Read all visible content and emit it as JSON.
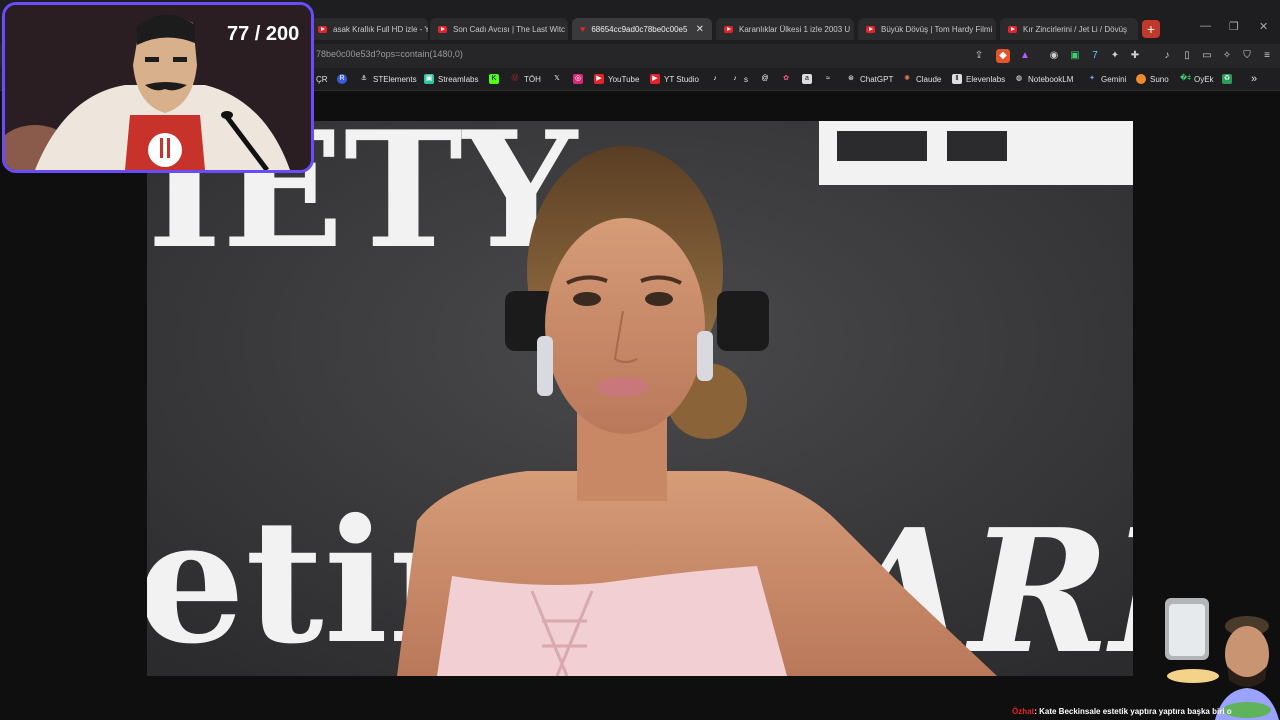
{
  "browser": {
    "tabs": [
      {
        "label": "asak Krallık Full HD izle - YouT",
        "icon": "youtube-icon",
        "active": false
      },
      {
        "label": "Son Cadı Avcısı | The Last Witc",
        "icon": "youtube-icon",
        "active": false
      },
      {
        "label": "68654cc9ad0c78be0c00e5",
        "icon": "heart-icon",
        "active": true
      },
      {
        "label": "Karanlıklar Ülkesi 1 izle 2003 U",
        "icon": "youtube-icon",
        "active": false
      },
      {
        "label": "Büyük Dövüş | Tom Hardy Filmi",
        "icon": "youtube-icon",
        "active": false
      },
      {
        "label": "Kır Zincirlerini / Jet Li / Dövüş",
        "icon": "youtube-icon",
        "active": false
      }
    ],
    "url": "78be0c00e53d?ops=contain(1480,0)",
    "bookmarks": [
      {
        "label": "ÇR",
        "icon": "bookmark-icon"
      },
      {
        "label": "",
        "icon": "r-icon"
      },
      {
        "label": "STElements",
        "icon": "anchor-icon"
      },
      {
        "label": "Streamlabs",
        "icon": "streamlabs-icon"
      },
      {
        "label": "",
        "icon": "kick-icon"
      },
      {
        "label": "TÖH",
        "icon": "toh-icon"
      },
      {
        "label": "",
        "icon": "x-icon"
      },
      {
        "label": "",
        "icon": "instagram-icon"
      },
      {
        "label": "YouTube",
        "icon": "youtube-icon"
      },
      {
        "label": "YT Studio",
        "icon": "yt-studio-icon"
      },
      {
        "label": "",
        "icon": "tiktok-icon"
      },
      {
        "label": "s",
        "icon": "tiktok-icon"
      },
      {
        "label": "ChatGPT",
        "icon": "chatgpt-icon"
      },
      {
        "label": "Claude",
        "icon": "claude-icon"
      },
      {
        "label": "Elevenlabs",
        "icon": "elevenlabs-icon"
      },
      {
        "label": "NotebookLM",
        "icon": "notebooklm-icon"
      },
      {
        "label": "Gemini",
        "icon": "gemini-icon"
      },
      {
        "label": "Suno",
        "icon": "suno-icon"
      },
      {
        "label": "OyEk",
        "icon": "oyek-icon"
      }
    ],
    "more_bookmarks": "»",
    "new_tab": "+"
  },
  "overlay": {
    "counter": "77 / 200"
  },
  "image": {
    "backdrop_text_left": "IETY",
    "backdrop_text_bottom_left": "etim",
    "backdrop_text_bottom_right": "ARI"
  },
  "ticker": {
    "user": "Özhat",
    "message": ": Kate Beckinsale estetik yaptıra yaptıra başka biri o"
  },
  "colors": {
    "accent_purple": "#6a4cff",
    "youtube_red": "#e3242b",
    "dress_pink": "#f1cfd2"
  }
}
